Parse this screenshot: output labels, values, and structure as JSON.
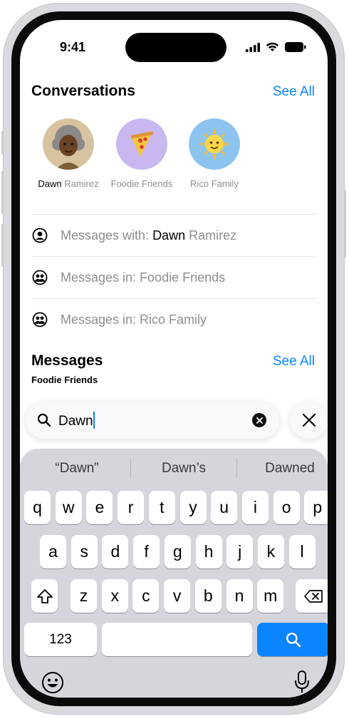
{
  "status": {
    "time": "9:41"
  },
  "conversations": {
    "title": "Conversations",
    "see_all": "See All",
    "avatars": [
      {
        "first": "Dawn",
        "rest": " Ramirez",
        "emoji": "👩🏿‍🦳",
        "bg": "#d8c3a0"
      },
      {
        "first": "",
        "rest": "Foodie Friends",
        "emoji": "🍕",
        "bg": "#c8b8ef"
      },
      {
        "first": "",
        "rest": "Rico Family",
        "emoji": "🌞",
        "bg": "#8cc4ef"
      }
    ],
    "rows": [
      {
        "prefix": "Messages with: ",
        "bold": "Dawn",
        "suffix": " Ramirez",
        "icon": "person-circle-icon"
      },
      {
        "prefix": "Messages in: Foodie Friends",
        "bold": "",
        "suffix": "",
        "icon": "group-circle-icon"
      },
      {
        "prefix": "Messages in: Rico Family",
        "bold": "",
        "suffix": "",
        "icon": "group-circle-icon"
      }
    ]
  },
  "messages": {
    "title": "Messages",
    "see_all": "See All",
    "group": "Foodie Friends"
  },
  "search": {
    "value": "Dawn"
  },
  "keyboard": {
    "suggestions": [
      "“Dawn”",
      "Dawn’s",
      "Dawned"
    ],
    "row1": [
      "q",
      "w",
      "e",
      "r",
      "t",
      "y",
      "u",
      "i",
      "o",
      "p"
    ],
    "row2": [
      "a",
      "s",
      "d",
      "f",
      "g",
      "h",
      "j",
      "k",
      "l"
    ],
    "row3": [
      "z",
      "x",
      "c",
      "v",
      "b",
      "n",
      "m"
    ],
    "numbers_label": "123"
  },
  "colors": {
    "accent": "#0a84ff"
  }
}
